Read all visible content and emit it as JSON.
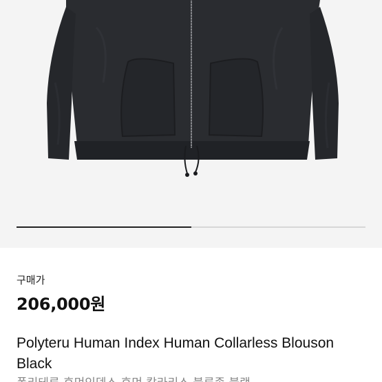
{
  "gallery": {
    "image_alt": "black collarless zip-up blouson jacket",
    "slide_progress": 0.5
  },
  "listing": {
    "price_label": "구매가",
    "price": "206,000원",
    "title": "Polyteru Human Index Human Collarless Blouson Black",
    "subtitle_korean": "폴리테루 휴먼인덱스 휴먼 칼라리스 블루종 블랙"
  },
  "colors": {
    "image_background": "#f4f4f4",
    "jacket": "#2a2c30",
    "progress_active": "#222222",
    "progress_track": "#d6d6d6"
  }
}
